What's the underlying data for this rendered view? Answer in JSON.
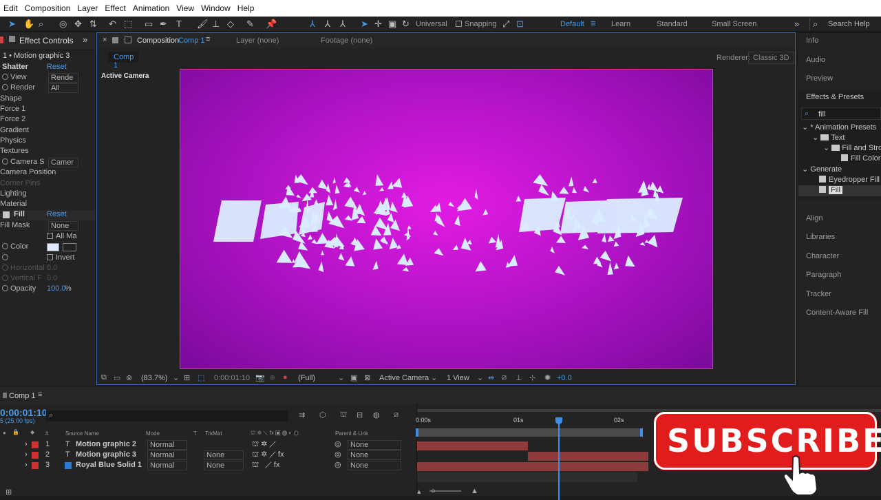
{
  "menu": [
    "Edit",
    "Composition",
    "Layer",
    "Effect",
    "Animation",
    "View",
    "Window",
    "Help"
  ],
  "toolbar": {
    "universal": "Universal",
    "snapping": "Snapping",
    "workspaces": [
      "Default",
      "Learn",
      "Standard",
      "Small Screen"
    ],
    "search_help": "Search Help"
  },
  "effect_controls": {
    "tab": "Effect Controls",
    "breadcrumb": "1 • Motion graphic 3",
    "shatter": {
      "name": "Shatter",
      "reset": "Reset",
      "view_label": "View",
      "view_value": "Rende",
      "render_label": "Render",
      "render_value": "All"
    },
    "groups": [
      "Shape",
      "Force 1",
      "Force 2",
      "Gradient",
      "Physics",
      "Textures"
    ],
    "camera_system_label": "Camera S",
    "camera_system_value": "Camer",
    "groups2": [
      "Camera Position",
      "Corner Pins",
      "Lighting",
      "Material"
    ],
    "fill": {
      "name": "Fill",
      "reset": "Reset",
      "fill_mask_label": "Fill Mask",
      "fill_mask_value": "None",
      "all_masks": "All Ma",
      "color_label": "Color",
      "invert": "Invert",
      "horizontal_label": "Horizontal",
      "horizontal_value": "0.0",
      "vertical_label": "Vertical F",
      "vertical_value": "0.0",
      "opacity_label": "Opacity",
      "opacity_value": "100.0",
      "opacity_unit": "%"
    }
  },
  "composition": {
    "tab_prefix": "Composition",
    "tab_name": "Comp 1",
    "layer_tab": "Layer",
    "layer_value": "(none)",
    "footage_tab": "Footage",
    "footage_value": "(none)",
    "subtab": "Comp 1",
    "renderer_label": "Renderer:",
    "renderer_value": "Classic 3D",
    "active_camera_label": "Active Camera",
    "magnification": "(83.7%)",
    "timecode": "0:00:01:10",
    "resolution": "(Full)",
    "camera": "Active Camera",
    "views": "1 View",
    "exposure": "+0.0",
    "bg_center": "#e31be3",
    "bg_edge": "#7a0a9c"
  },
  "right_panel": {
    "items_top": [
      "Info",
      "Audio",
      "Preview",
      "Effects & Presets"
    ],
    "search_value": "fill",
    "tree": {
      "animation_presets": "* Animation Presets",
      "text": "Text",
      "fill_and_stroke": "Fill and Strok",
      "fill_color": "Fill Color",
      "generate": "Generate",
      "eyedropper_fill": "Eyedropper Fill",
      "fill": "Fill"
    },
    "items_bottom": [
      "Align",
      "Libraries",
      "Character",
      "Paragraph",
      "Tracker",
      "Content-Aware Fill"
    ]
  },
  "timeline": {
    "tab": "Comp 1",
    "timecode": "0:00:01:10",
    "fps": "5 (25.00 fps)",
    "columns": {
      "num": "#",
      "source": "Source Name",
      "mode": "Mode",
      "t": "T",
      "trkmat": "TrkMat",
      "parent": "Parent & Link"
    },
    "ruler": [
      "0:00s",
      "01s",
      "02s"
    ],
    "layers": [
      {
        "num": "1",
        "type": "T",
        "name": "Motion graphic 2",
        "mode": "Normal",
        "trkmat": "",
        "parent": "None",
        "bar_start": 0,
        "bar_end": 1.1
      },
      {
        "num": "2",
        "type": "T",
        "name": "Motion graphic 3",
        "mode": "Normal",
        "trkmat": "None",
        "parent": "None",
        "bar_start": 1.1,
        "bar_end": 2.3
      },
      {
        "num": "3",
        "type": "solid",
        "name": "Royal Blue Solid 1",
        "mode": "Normal",
        "trkmat": "None",
        "parent": "None",
        "bar_start": 0,
        "bar_end": 2.3
      }
    ]
  },
  "overlay": {
    "subscribe": "SUBSCRIBE",
    "color": "#e01c1c"
  }
}
